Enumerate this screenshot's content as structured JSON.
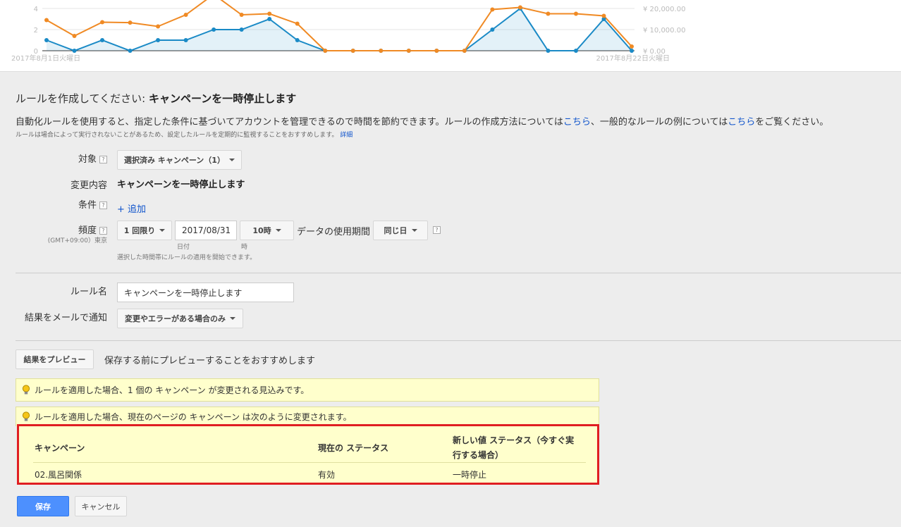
{
  "chart_data": {
    "type": "line",
    "x": [
      "2017-08-01",
      "2017-08-02",
      "2017-08-03",
      "2017-08-04",
      "2017-08-05",
      "2017-08-06",
      "2017-08-07",
      "2017-08-08",
      "2017-08-09",
      "2017-08-10",
      "2017-08-11",
      "2017-08-12",
      "2017-08-13",
      "2017-08-14",
      "2017-08-15",
      "2017-08-16",
      "2017-08-17",
      "2017-08-18",
      "2017-08-19",
      "2017-08-20",
      "2017-08-21",
      "2017-08-22"
    ],
    "x_start_label": "2017年8月1日火曜日",
    "x_end_label": "2017年8月22日火曜日",
    "left_ticks": [
      "4",
      "2",
      "0"
    ],
    "right_ticks": [
      "¥ 20,000.00",
      "¥ 10,000.00",
      "¥ 0.00"
    ],
    "ylim_left": [
      0,
      4
    ],
    "ylim_right": [
      0,
      20000
    ],
    "series": [
      {
        "color": "#1a8ac6",
        "axis": "left",
        "area": true,
        "values": [
          1,
          0,
          1,
          0,
          1,
          1,
          2,
          2,
          3,
          1,
          0,
          0,
          0,
          0,
          0,
          0,
          2,
          4,
          0,
          0,
          3,
          0
        ]
      },
      {
        "color": "#f08a24",
        "axis": "right",
        "area": false,
        "values": [
          14500,
          7000,
          13500,
          13300,
          11500,
          17000,
          28000,
          17000,
          17500,
          12800,
          0,
          0,
          0,
          0,
          0,
          0,
          19500,
          20500,
          17500,
          17500,
          16500,
          2000
        ]
      }
    ]
  },
  "form": {
    "title_prefix": "ルールを作成してください: ",
    "title_bold": "キャンペーンを一時停止します",
    "desc_1": "自動化ルールを使用すると、指定した条件に基づいてアカウントを管理できるので時間を節約できます。ルールの作成方法については",
    "desc_link1": "こちら",
    "desc_2": "、一般的なルールの例については",
    "desc_link2": "こちら",
    "desc_3": "をご覧ください。",
    "note": "ルールは場合によって実行されないことがあるため、設定したルールを定期的に監視することをおすすめします。",
    "note_link": "詳細",
    "target_label": "対象",
    "target_value": "選択済み キャンペーン（1）",
    "change_label": "変更内容",
    "change_value": "キャンペーンを一時停止します",
    "condition_label": "条件",
    "condition_add": "+ 追加",
    "freq_label": "頻度",
    "freq_tz": "(GMT+09:00）東京",
    "freq_value": "1 回限り",
    "date_value": "2017/08/31",
    "date_caption": "日付",
    "hour_value": "10時",
    "hour_caption": "時",
    "data_period_label": "データの使用期間",
    "data_period_value": "同じ日",
    "freq_note": "選択した時間帯にルールの適用を開始できます。",
    "qmark": "?",
    "rule_name_label": "ルール名",
    "rule_name_value": "キャンペーンを一時停止します",
    "email_label": "結果をメールで通知",
    "email_value": "変更やエラーがある場合のみ"
  },
  "preview": {
    "button": "結果をプレビュー",
    "hint": "保存する前にプレビューすることをおすすめします",
    "msg1": "ルールを適用した場合、1 個の キャンペーン が変更される見込みです。",
    "msg2": "ルールを適用した場合、現在のページの キャンペーン は次のように変更されます。",
    "col_campaign": "キャンペーン",
    "col_current": "現在の ステータス",
    "col_new_1": "新しい値 ステータス（今すぐ実",
    "col_new_2": "行する場合）",
    "row_campaign": "02.風呂関係",
    "row_current": "有効",
    "row_new": "一時停止"
  },
  "actions": {
    "save": "保存",
    "cancel": "キャンセル"
  }
}
